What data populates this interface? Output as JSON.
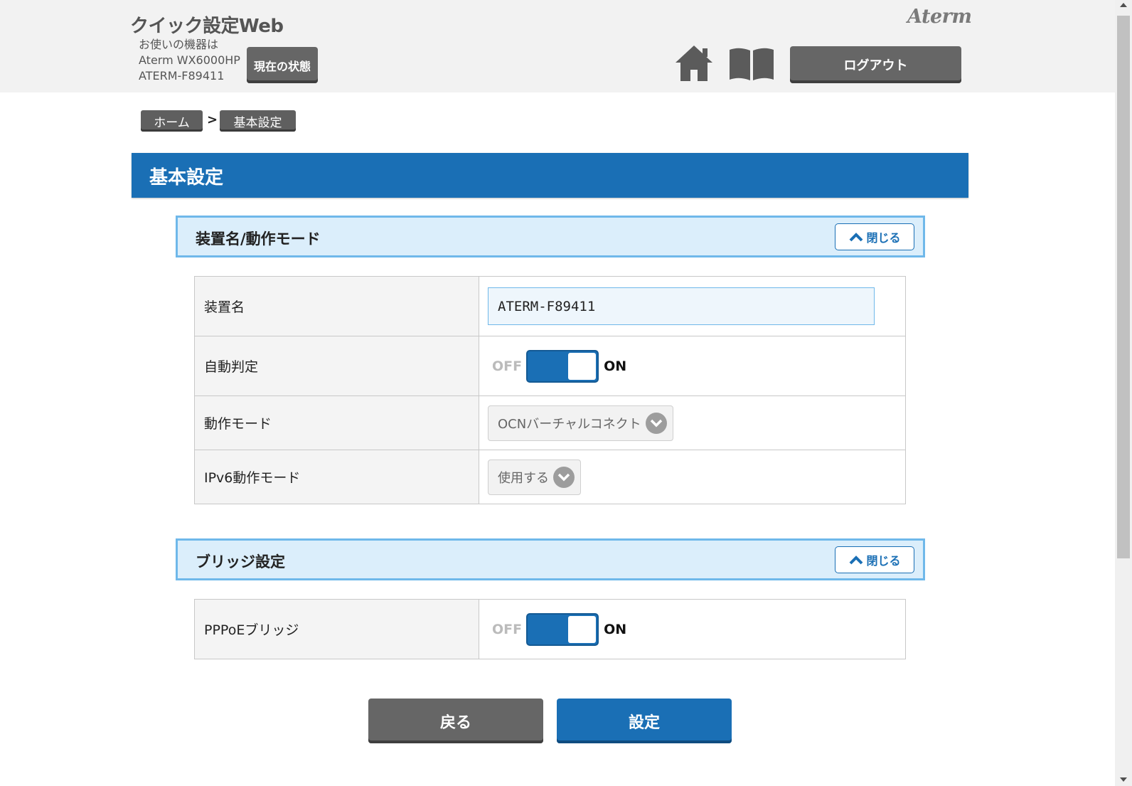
{
  "header": {
    "app_title": "クイック設定Web",
    "device_info": {
      "line1": "お使いの機器は",
      "model": "Aterm WX6000HP",
      "name": "ATERM-F89411"
    },
    "status_button": "現在の状態",
    "logo_text": "Aterm",
    "home_icon": "home-icon",
    "manual_icon": "book-icon",
    "logout_button": "ログアウト"
  },
  "breadcrumb": {
    "home": "ホーム",
    "separator": ">",
    "current": "基本設定"
  },
  "page": {
    "title": "基本設定"
  },
  "sections": [
    {
      "title": "装置名/動作モード",
      "close_label": "閉じる",
      "rows": [
        {
          "label": "装置名",
          "type": "text",
          "value": "ATERM-F89411"
        },
        {
          "label": "自動判定",
          "type": "toggle",
          "off": "OFF",
          "on": "ON",
          "state": "ON"
        },
        {
          "label": "動作モード",
          "type": "select",
          "value": "OCNバーチャルコネクト"
        },
        {
          "label": "IPv6動作モード",
          "type": "select",
          "value": "使用する"
        }
      ]
    },
    {
      "title": "ブリッジ設定",
      "close_label": "閉じる",
      "rows": [
        {
          "label": "PPPoEブリッジ",
          "type": "toggle",
          "off": "OFF",
          "on": "ON",
          "state": "ON"
        }
      ]
    }
  ],
  "footer": {
    "back_button": "戻る",
    "submit_button": "設定"
  },
  "colors": {
    "primary": "#1a6fb5",
    "section_bg": "#dbeefb",
    "section_border": "#6fb8ea",
    "button_gray": "#666666"
  }
}
